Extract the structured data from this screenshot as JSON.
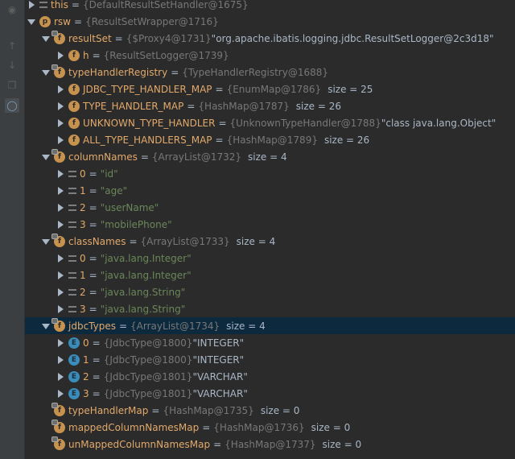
{
  "gutter": {
    "items": [
      {
        "icon": "debug-bug-icon"
      },
      {
        "icon": "arrow-up-icon"
      },
      {
        "icon": "arrow-down-icon"
      },
      {
        "icon": "copy-icon"
      },
      {
        "icon": "glasses-icon",
        "active": true
      }
    ]
  },
  "tree": {
    "rows": [
      {
        "depth": 0,
        "arrow": "collapsed",
        "icon": "equals",
        "name": "this",
        "ref": "{DefaultResultSetHandler@1675}"
      },
      {
        "depth": 0,
        "arrow": "expanded",
        "icon": "field-p",
        "badge": "p",
        "name": "rsw",
        "ref": "{ResultSetWrapper@1716}"
      },
      {
        "depth": 1,
        "arrow": "expanded",
        "icon": "field-lock",
        "badge": "f",
        "name": "resultSet",
        "ref": "{$Proxy4@1731}",
        "value": "\"org.apache.ibatis.logging.jdbc.ResultSetLogger@2c3d18\"",
        "value_type": "plain"
      },
      {
        "depth": 2,
        "arrow": "collapsed",
        "icon": "field",
        "badge": "f",
        "name": "h",
        "ref": "{ResultSetLogger@1739}"
      },
      {
        "depth": 1,
        "arrow": "expanded",
        "icon": "field-lock",
        "badge": "f",
        "name": "typeHandlerRegistry",
        "ref": "{TypeHandlerRegistry@1688}"
      },
      {
        "depth": 2,
        "arrow": "collapsed",
        "icon": "field",
        "badge": "f",
        "name": "JDBC_TYPE_HANDLER_MAP",
        "ref": "{EnumMap@1786}",
        "size": "size = 25"
      },
      {
        "depth": 2,
        "arrow": "collapsed",
        "icon": "field",
        "badge": "f",
        "name": "TYPE_HANDLER_MAP",
        "ref": "{HashMap@1787}",
        "size": "size = 26"
      },
      {
        "depth": 2,
        "arrow": "collapsed",
        "icon": "field",
        "badge": "f",
        "name": "UNKNOWN_TYPE_HANDLER",
        "ref": "{UnknownTypeHandler@1788}",
        "value": "\"class java.lang.Object\"",
        "value_type": "plain"
      },
      {
        "depth": 2,
        "arrow": "collapsed",
        "icon": "field",
        "badge": "f",
        "name": "ALL_TYPE_HANDLERS_MAP",
        "ref": "{HashMap@1789}",
        "size": "size = 26"
      },
      {
        "depth": 1,
        "arrow": "expanded",
        "icon": "field-lock",
        "badge": "f",
        "name": "columnNames",
        "ref": "{ArrayList@1732}",
        "size": "size = 4"
      },
      {
        "depth": 2,
        "arrow": "collapsed",
        "icon": "equals",
        "index": "0",
        "value": "\"id\"",
        "value_type": "string"
      },
      {
        "depth": 2,
        "arrow": "collapsed",
        "icon": "equals",
        "index": "1",
        "value": "\"age\"",
        "value_type": "string"
      },
      {
        "depth": 2,
        "arrow": "collapsed",
        "icon": "equals",
        "index": "2",
        "value": "\"userName\"",
        "value_type": "string"
      },
      {
        "depth": 2,
        "arrow": "collapsed",
        "icon": "equals",
        "index": "3",
        "value": "\"mobilePhone\"",
        "value_type": "string"
      },
      {
        "depth": 1,
        "arrow": "expanded",
        "icon": "field-lock",
        "badge": "f",
        "name": "classNames",
        "ref": "{ArrayList@1733}",
        "size": "size = 4"
      },
      {
        "depth": 2,
        "arrow": "collapsed",
        "icon": "equals",
        "index": "0",
        "value": "\"java.lang.Integer\"",
        "value_type": "string"
      },
      {
        "depth": 2,
        "arrow": "collapsed",
        "icon": "equals",
        "index": "1",
        "value": "\"java.lang.Integer\"",
        "value_type": "string"
      },
      {
        "depth": 2,
        "arrow": "collapsed",
        "icon": "equals",
        "index": "2",
        "value": "\"java.lang.String\"",
        "value_type": "string"
      },
      {
        "depth": 2,
        "arrow": "collapsed",
        "icon": "equals",
        "index": "3",
        "value": "\"java.lang.String\"",
        "value_type": "string"
      },
      {
        "depth": 1,
        "arrow": "expanded",
        "icon": "field-lock",
        "badge": "f",
        "name": "jdbcTypes",
        "ref": "{ArrayList@1734}",
        "size": "size = 4",
        "selected": true
      },
      {
        "depth": 2,
        "arrow": "collapsed",
        "icon": "enum",
        "badge": "E",
        "index": "0",
        "ref": "{JdbcType@1800}",
        "value": "\"INTEGER\"",
        "value_type": "plain"
      },
      {
        "depth": 2,
        "arrow": "collapsed",
        "icon": "enum",
        "badge": "E",
        "index": "1",
        "ref": "{JdbcType@1800}",
        "value": "\"INTEGER\"",
        "value_type": "plain"
      },
      {
        "depth": 2,
        "arrow": "collapsed",
        "icon": "enum",
        "badge": "E",
        "index": "2",
        "ref": "{JdbcType@1801}",
        "value": "\"VARCHAR\"",
        "value_type": "plain"
      },
      {
        "depth": 2,
        "arrow": "collapsed",
        "icon": "enum",
        "badge": "E",
        "index": "3",
        "ref": "{JdbcType@1801}",
        "value": "\"VARCHAR\"",
        "value_type": "plain"
      },
      {
        "depth": 1,
        "arrow": "none",
        "icon": "field-lock",
        "badge": "f",
        "name": "typeHandlerMap",
        "ref": "{HashMap@1735}",
        "size": "size = 0"
      },
      {
        "depth": 1,
        "arrow": "none",
        "icon": "field-lock",
        "badge": "f",
        "name": "mappedColumnNamesMap",
        "ref": "{HashMap@1736}",
        "size": "size = 0"
      },
      {
        "depth": 1,
        "arrow": "none",
        "icon": "field-lock",
        "badge": "f",
        "name": "unMappedColumnNamesMap",
        "ref": "{HashMap@1737}",
        "size": "size = 0"
      }
    ]
  }
}
